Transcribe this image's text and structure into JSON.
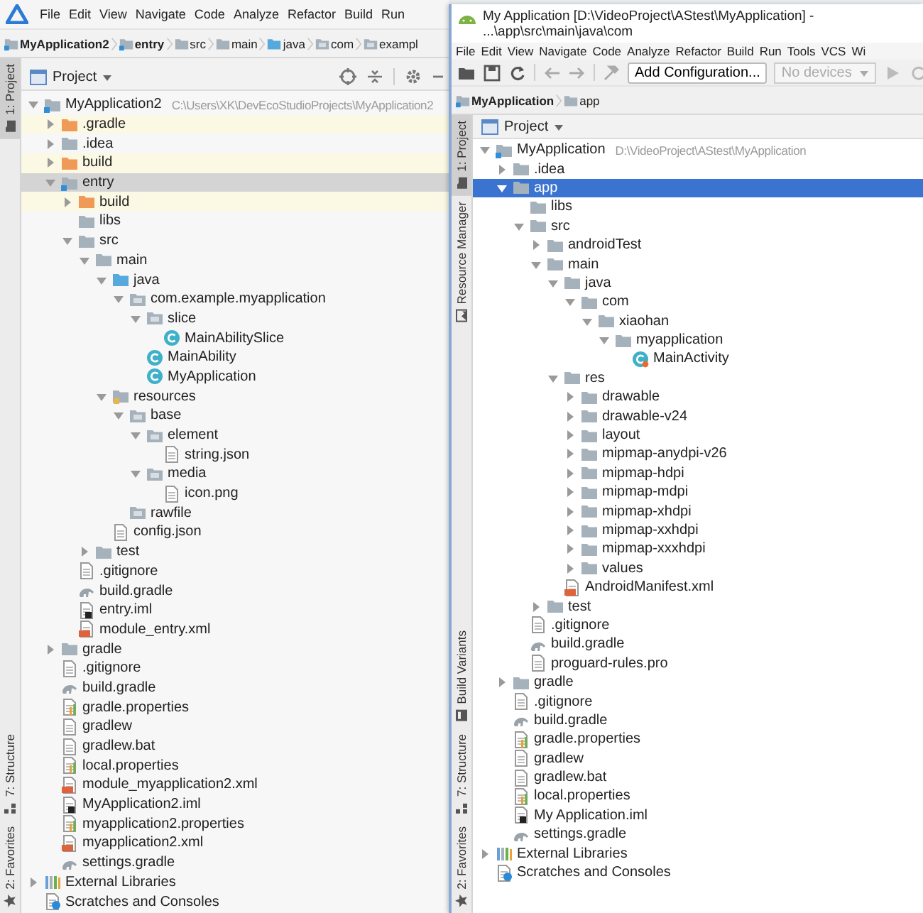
{
  "windows": [
    {
      "kind": "deveco",
      "focused": false,
      "menu": [
        "File",
        "Edit",
        "View",
        "Navigate",
        "Code",
        "Analyze",
        "Refactor",
        "Build",
        "Run"
      ],
      "breadcrumbs": [
        {
          "label": "MyApplication2",
          "kind": "module"
        },
        {
          "label": "entry",
          "kind": "module"
        },
        {
          "label": "src",
          "kind": "folder"
        },
        {
          "label": "main",
          "kind": "folder"
        },
        {
          "label": "java",
          "kind": "folder-source"
        },
        {
          "label": "com",
          "kind": "package"
        },
        {
          "label": "exampl",
          "kind": "package"
        }
      ],
      "side_tabs_top": [
        {
          "label": "1: Project",
          "kind": "project",
          "selected": true
        }
      ],
      "side_tabs_bottom": [
        {
          "label": "7: Structure",
          "kind": "structure",
          "selected": false
        },
        {
          "label": "2: Favorites",
          "kind": "favorites",
          "selected": false
        }
      ],
      "panel": {
        "label": "Project"
      },
      "tree": [
        {
          "label": "MyApplication2",
          "path": "C:\\Users\\XK\\DevEcoStudioProjects\\MyApplication2",
          "kind": "module",
          "expanded": true,
          "selected": false,
          "children": [
            {
              "label": ".gradle",
              "kind": "folder-excluded",
              "expanded": false,
              "selected": false
            },
            {
              "label": ".idea",
              "kind": "folder",
              "expanded": false,
              "selected": false
            },
            {
              "label": "build",
              "kind": "folder-excluded",
              "expanded": false,
              "selected": false
            },
            {
              "label": "entry",
              "kind": "module",
              "expanded": true,
              "selected": true,
              "children": [
                {
                  "label": "build",
                  "kind": "folder-excluded",
                  "expanded": false,
                  "selected": false
                },
                {
                  "label": "libs",
                  "kind": "folder",
                  "selected": false
                },
                {
                  "label": "src",
                  "kind": "folder",
                  "expanded": true,
                  "selected": false,
                  "children": [
                    {
                      "label": "main",
                      "kind": "folder",
                      "expanded": true,
                      "selected": false,
                      "children": [
                        {
                          "label": "java",
                          "kind": "folder-source",
                          "expanded": true,
                          "selected": false,
                          "children": [
                            {
                              "label": "com.example.myapplication",
                              "kind": "package",
                              "expanded": true,
                              "selected": false,
                              "children": [
                                {
                                  "label": "slice",
                                  "kind": "package",
                                  "expanded": true,
                                  "selected": false,
                                  "children": [
                                    {
                                      "label": "MainAbilitySlice",
                                      "kind": "class",
                                      "selected": false
                                    }
                                  ]
                                },
                                {
                                  "label": "MainAbility",
                                  "kind": "class",
                                  "selected": false
                                },
                                {
                                  "label": "MyApplication",
                                  "kind": "class",
                                  "selected": false
                                }
                              ]
                            }
                          ]
                        },
                        {
                          "label": "resources",
                          "kind": "folder-resources",
                          "expanded": true,
                          "selected": false,
                          "children": [
                            {
                              "label": "base",
                              "kind": "package",
                              "expanded": true,
                              "selected": false,
                              "children": [
                                {
                                  "label": "element",
                                  "kind": "package",
                                  "expanded": true,
                                  "selected": false,
                                  "children": [
                                    {
                                      "label": "string.json",
                                      "kind": "file",
                                      "selected": false
                                    }
                                  ]
                                },
                                {
                                  "label": "media",
                                  "kind": "package",
                                  "expanded": true,
                                  "selected": false,
                                  "children": [
                                    {
                                      "label": "icon.png",
                                      "kind": "file",
                                      "selected": false
                                    }
                                  ]
                                }
                              ]
                            },
                            {
                              "label": "rawfile",
                              "kind": "package",
                              "selected": false
                            }
                          ]
                        },
                        {
                          "label": "config.json",
                          "kind": "file",
                          "selected": false
                        }
                      ]
                    },
                    {
                      "label": "test",
                      "kind": "folder",
                      "expanded": false,
                      "selected": false
                    }
                  ]
                },
                {
                  "label": ".gitignore",
                  "kind": "file",
                  "selected": false
                },
                {
                  "label": "build.gradle",
                  "kind": "gradle",
                  "selected": false
                },
                {
                  "label": "entry.iml",
                  "kind": "iml",
                  "selected": false
                },
                {
                  "label": "module_entry.xml",
                  "kind": "xml",
                  "selected": false
                }
              ]
            },
            {
              "label": "gradle",
              "kind": "folder",
              "expanded": false,
              "selected": false
            },
            {
              "label": ".gitignore",
              "kind": "file",
              "selected": false
            },
            {
              "label": "build.gradle",
              "kind": "gradle",
              "selected": false
            },
            {
              "label": "gradle.properties",
              "kind": "properties",
              "selected": false
            },
            {
              "label": "gradlew",
              "kind": "file",
              "selected": false
            },
            {
              "label": "gradlew.bat",
              "kind": "file",
              "selected": false
            },
            {
              "label": "local.properties",
              "kind": "properties",
              "selected": false
            },
            {
              "label": "module_myapplication2.xml",
              "kind": "xml",
              "selected": false
            },
            {
              "label": "MyApplication2.iml",
              "kind": "iml",
              "selected": false
            },
            {
              "label": "myapplication2.properties",
              "kind": "properties",
              "selected": false
            },
            {
              "label": "myapplication2.xml",
              "kind": "xml",
              "selected": false
            },
            {
              "label": "settings.gradle",
              "kind": "gradle",
              "selected": false
            }
          ]
        },
        {
          "label": "External Libraries",
          "kind": "libraries",
          "expanded": false,
          "selected": false
        },
        {
          "label": "Scratches and Consoles",
          "kind": "scratches",
          "selected": false
        }
      ]
    },
    {
      "kind": "android",
      "focused": true,
      "title": "My Application [D:\\VideoProject\\AStest\\MyApplication] - ...\\app\\src\\main\\java\\com",
      "menu": [
        "File",
        "Edit",
        "View",
        "Navigate",
        "Code",
        "Analyze",
        "Refactor",
        "Build",
        "Run",
        "Tools",
        "VCS",
        "Wi"
      ],
      "toolbar": {
        "config_button": "Add Configuration...",
        "device_dropdown": {
          "label": "No devices",
          "disabled": true
        }
      },
      "breadcrumbs": [
        {
          "label": "MyApplication",
          "kind": "module"
        },
        {
          "label": "app",
          "kind": "folder"
        }
      ],
      "side_tabs_top": [
        {
          "label": "1: Project",
          "kind": "project",
          "selected": true
        },
        {
          "label": "Resource Manager",
          "kind": "resources",
          "selected": false
        }
      ],
      "side_tabs_bottom": [
        {
          "label": "Build Variants",
          "kind": "variants",
          "selected": false
        },
        {
          "label": "7: Structure",
          "kind": "structure",
          "selected": false
        },
        {
          "label": "2: Favorites",
          "kind": "favorites",
          "selected": false
        }
      ],
      "panel": {
        "label": "Project"
      },
      "tree": [
        {
          "label": "MyApplication",
          "path": "D:\\VideoProject\\AStest\\MyApplication",
          "kind": "module",
          "expanded": true,
          "selected": false,
          "children": [
            {
              "label": ".idea",
              "kind": "folder",
              "expanded": false,
              "selected": false
            },
            {
              "label": "app",
              "kind": "folder",
              "expanded": true,
              "selected": true,
              "children": [
                {
                  "label": "libs",
                  "kind": "folder",
                  "selected": false
                },
                {
                  "label": "src",
                  "kind": "folder",
                  "expanded": true,
                  "selected": false,
                  "children": [
                    {
                      "label": "androidTest",
                      "kind": "folder",
                      "expanded": false,
                      "selected": false
                    },
                    {
                      "label": "main",
                      "kind": "folder",
                      "expanded": true,
                      "selected": false,
                      "children": [
                        {
                          "label": "java",
                          "kind": "folder",
                          "expanded": true,
                          "selected": false,
                          "children": [
                            {
                              "label": "com",
                              "kind": "folder",
                              "expanded": true,
                              "selected": false,
                              "children": [
                                {
                                  "label": "xiaohan",
                                  "kind": "folder",
                                  "expanded": true,
                                  "selected": false,
                                  "children": [
                                    {
                                      "label": "myapplication",
                                      "kind": "folder",
                                      "expanded": true,
                                      "selected": false,
                                      "children": [
                                        {
                                          "label": "MainActivity",
                                          "kind": "activity",
                                          "selected": false
                                        }
                                      ]
                                    }
                                  ]
                                }
                              ]
                            }
                          ]
                        },
                        {
                          "label": "res",
                          "kind": "folder",
                          "expanded": true,
                          "selected": false,
                          "children": [
                            {
                              "label": "drawable",
                              "kind": "folder",
                              "expanded": false,
                              "selected": false
                            },
                            {
                              "label": "drawable-v24",
                              "kind": "folder",
                              "expanded": false,
                              "selected": false
                            },
                            {
                              "label": "layout",
                              "kind": "folder",
                              "expanded": false,
                              "selected": false
                            },
                            {
                              "label": "mipmap-anydpi-v26",
                              "kind": "folder",
                              "expanded": false,
                              "selected": false
                            },
                            {
                              "label": "mipmap-hdpi",
                              "kind": "folder",
                              "expanded": false,
                              "selected": false
                            },
                            {
                              "label": "mipmap-mdpi",
                              "kind": "folder",
                              "expanded": false,
                              "selected": false
                            },
                            {
                              "label": "mipmap-xhdpi",
                              "kind": "folder",
                              "expanded": false,
                              "selected": false
                            },
                            {
                              "label": "mipmap-xxhdpi",
                              "kind": "folder",
                              "expanded": false,
                              "selected": false
                            },
                            {
                              "label": "mipmap-xxxhdpi",
                              "kind": "folder",
                              "expanded": false,
                              "selected": false
                            },
                            {
                              "label": "values",
                              "kind": "folder",
                              "expanded": false,
                              "selected": false
                            }
                          ]
                        },
                        {
                          "label": "AndroidManifest.xml",
                          "kind": "xml",
                          "selected": false
                        }
                      ]
                    },
                    {
                      "label": "test",
                      "kind": "folder",
                      "expanded": false,
                      "selected": false
                    }
                  ]
                },
                {
                  "label": ".gitignore",
                  "kind": "file",
                  "selected": false
                },
                {
                  "label": "build.gradle",
                  "kind": "gradle",
                  "selected": false
                },
                {
                  "label": "proguard-rules.pro",
                  "kind": "file",
                  "selected": false
                }
              ]
            },
            {
              "label": "gradle",
              "kind": "folder",
              "expanded": false,
              "selected": false
            },
            {
              "label": ".gitignore",
              "kind": "file",
              "selected": false
            },
            {
              "label": "build.gradle",
              "kind": "gradle",
              "selected": false
            },
            {
              "label": "gradle.properties",
              "kind": "properties",
              "selected": false
            },
            {
              "label": "gradlew",
              "kind": "file",
              "selected": false
            },
            {
              "label": "gradlew.bat",
              "kind": "file",
              "selected": false
            },
            {
              "label": "local.properties",
              "kind": "properties",
              "selected": false
            },
            {
              "label": "My Application.iml",
              "kind": "iml",
              "selected": false
            },
            {
              "label": "settings.gradle",
              "kind": "gradle",
              "selected": false
            }
          ]
        },
        {
          "label": "External Libraries",
          "kind": "libraries",
          "expanded": false,
          "selected": false
        },
        {
          "label": "Scratches and Consoles",
          "kind": "scratches",
          "selected": false
        }
      ]
    }
  ]
}
